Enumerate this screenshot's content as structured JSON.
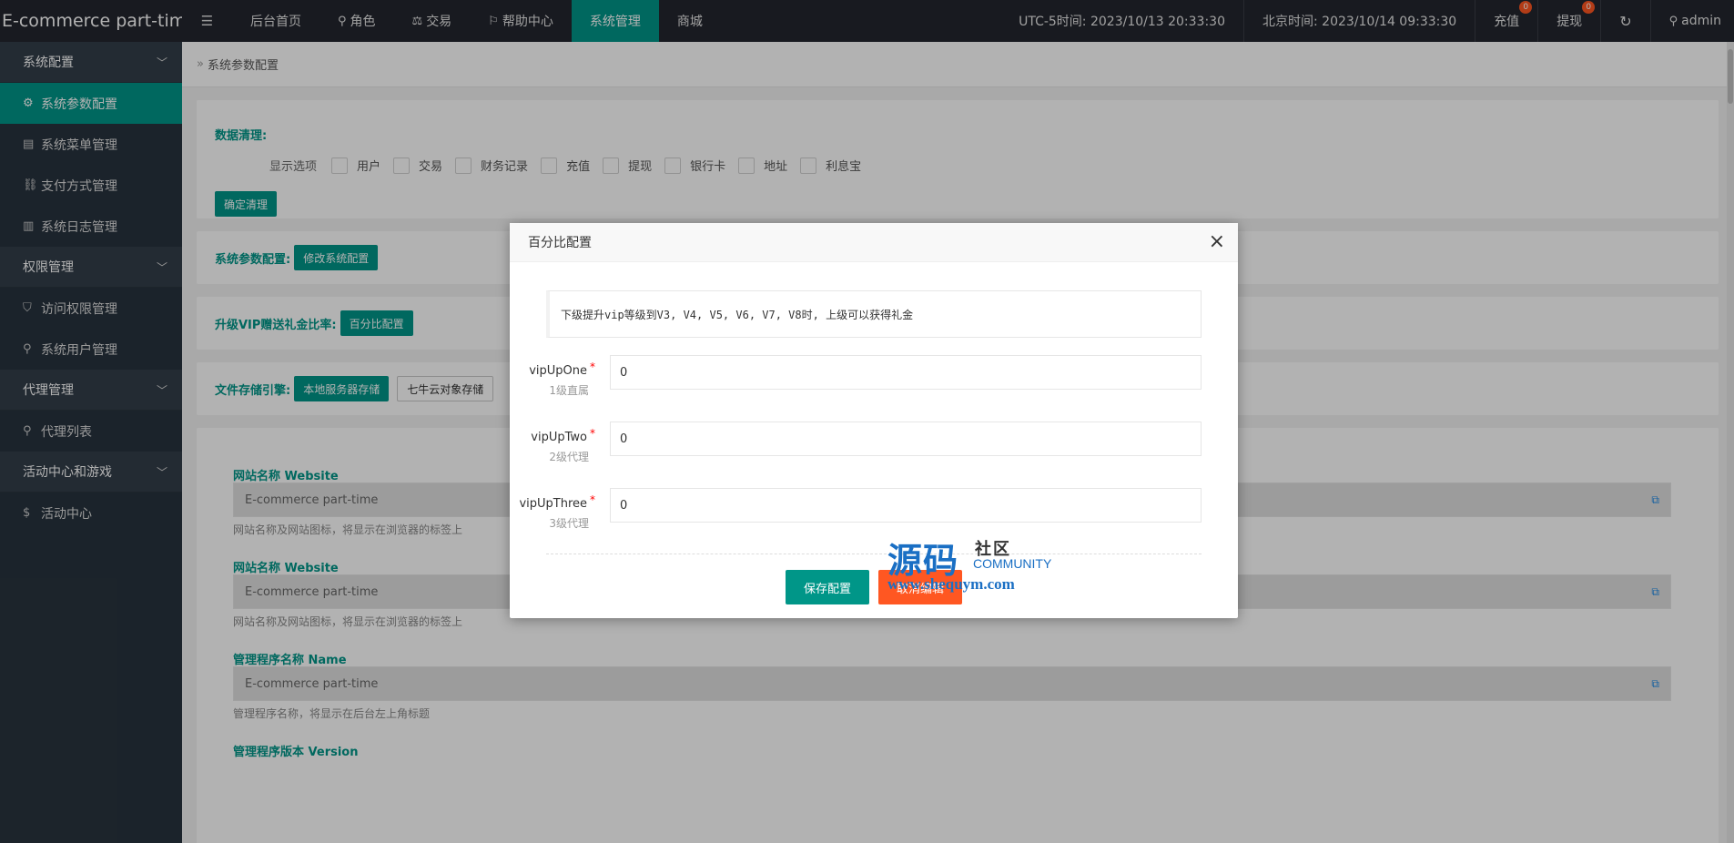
{
  "brand": "E-commerce part-time",
  "nav": [
    {
      "label": "后台首页",
      "icon": ""
    },
    {
      "label": "角色",
      "icon": "user-icon"
    },
    {
      "label": "交易",
      "icon": "scale-icon"
    },
    {
      "label": "帮助中心",
      "icon": "flag-icon"
    },
    {
      "label": "系统管理",
      "icon": "",
      "active": true
    },
    {
      "label": "商城",
      "icon": ""
    }
  ],
  "top_right": {
    "utc_time": "UTC-5时间: 2023/10/13 20:33:30",
    "beijing_time": "北京时间: 2023/10/14 09:33:30",
    "recharge": "充值",
    "recharge_badge": "0",
    "withdraw": "提现",
    "withdraw_badge": "0",
    "user": "admin"
  },
  "sidebar": {
    "groups": [
      {
        "label": "系统配置",
        "items": [
          {
            "label": "系统参数配置",
            "icon": "gear-icon",
            "active": true
          },
          {
            "label": "系统菜单管理",
            "icon": "menu-icon"
          },
          {
            "label": "支付方式管理",
            "icon": "link-icon"
          },
          {
            "label": "系统日志管理",
            "icon": "log-icon"
          }
        ]
      },
      {
        "label": "权限管理",
        "items": [
          {
            "label": "访问权限管理",
            "icon": "shield-icon"
          },
          {
            "label": "系统用户管理",
            "icon": "user-icon"
          }
        ]
      },
      {
        "label": "代理管理",
        "items": [
          {
            "label": "代理列表",
            "icon": "user-icon"
          }
        ]
      },
      {
        "label": "活动中心和游戏",
        "items": [
          {
            "label": "活动中心",
            "icon": "dollar-icon"
          }
        ]
      }
    ]
  },
  "breadcrumb": "系统参数配置",
  "data_clean": {
    "title": "数据清理:",
    "show_options": "显示选项",
    "options": [
      "用户",
      "交易",
      "财务记录",
      "充值",
      "提现",
      "银行卡",
      "地址",
      "利息宝"
    ],
    "confirm": "确定清理"
  },
  "sys_params": {
    "label": "系统参数配置:",
    "button": "修改系统配置"
  },
  "vip_ratio": {
    "label": "升级VIP赠送礼金比率:",
    "button": "百分比配置"
  },
  "storage": {
    "label": "文件存储引擎:",
    "buttons": [
      "本地服务器存储",
      "七牛云对象存储"
    ]
  },
  "fields": [
    {
      "label": "网站名称 Website",
      "value": "E-commerce part-time",
      "help": "网站名称及网站图标，将显示在浏览器的标签上"
    },
    {
      "label": "网站名称 Website",
      "value": "E-commerce part-time",
      "help": "网站名称及网站图标，将显示在浏览器的标签上"
    },
    {
      "label": "管理程序名称 Name",
      "value": "E-commerce part-time",
      "help": "管理程序名称，将显示在后台左上角标题"
    },
    {
      "label": "管理程序版本 Version",
      "value": "",
      "help": ""
    }
  ],
  "modal": {
    "title": "百分比配置",
    "tip": "下级提升vip等级到V3, V4, V5, V6, V7, V8时, 上级可以获得礼金",
    "rows": [
      {
        "label": "vipUpOne",
        "sub": "1级直属",
        "value": "0"
      },
      {
        "label": "vipUpTwo",
        "sub": "2级代理",
        "value": "0"
      },
      {
        "label": "vipUpThree",
        "sub": "3级代理",
        "value": "0"
      }
    ],
    "save": "保存配置",
    "reset": "取消编辑"
  },
  "watermark": {
    "big": "源码",
    "small": "社区",
    "community": "COMMUNITY",
    "url": "www.shequym.com"
  }
}
